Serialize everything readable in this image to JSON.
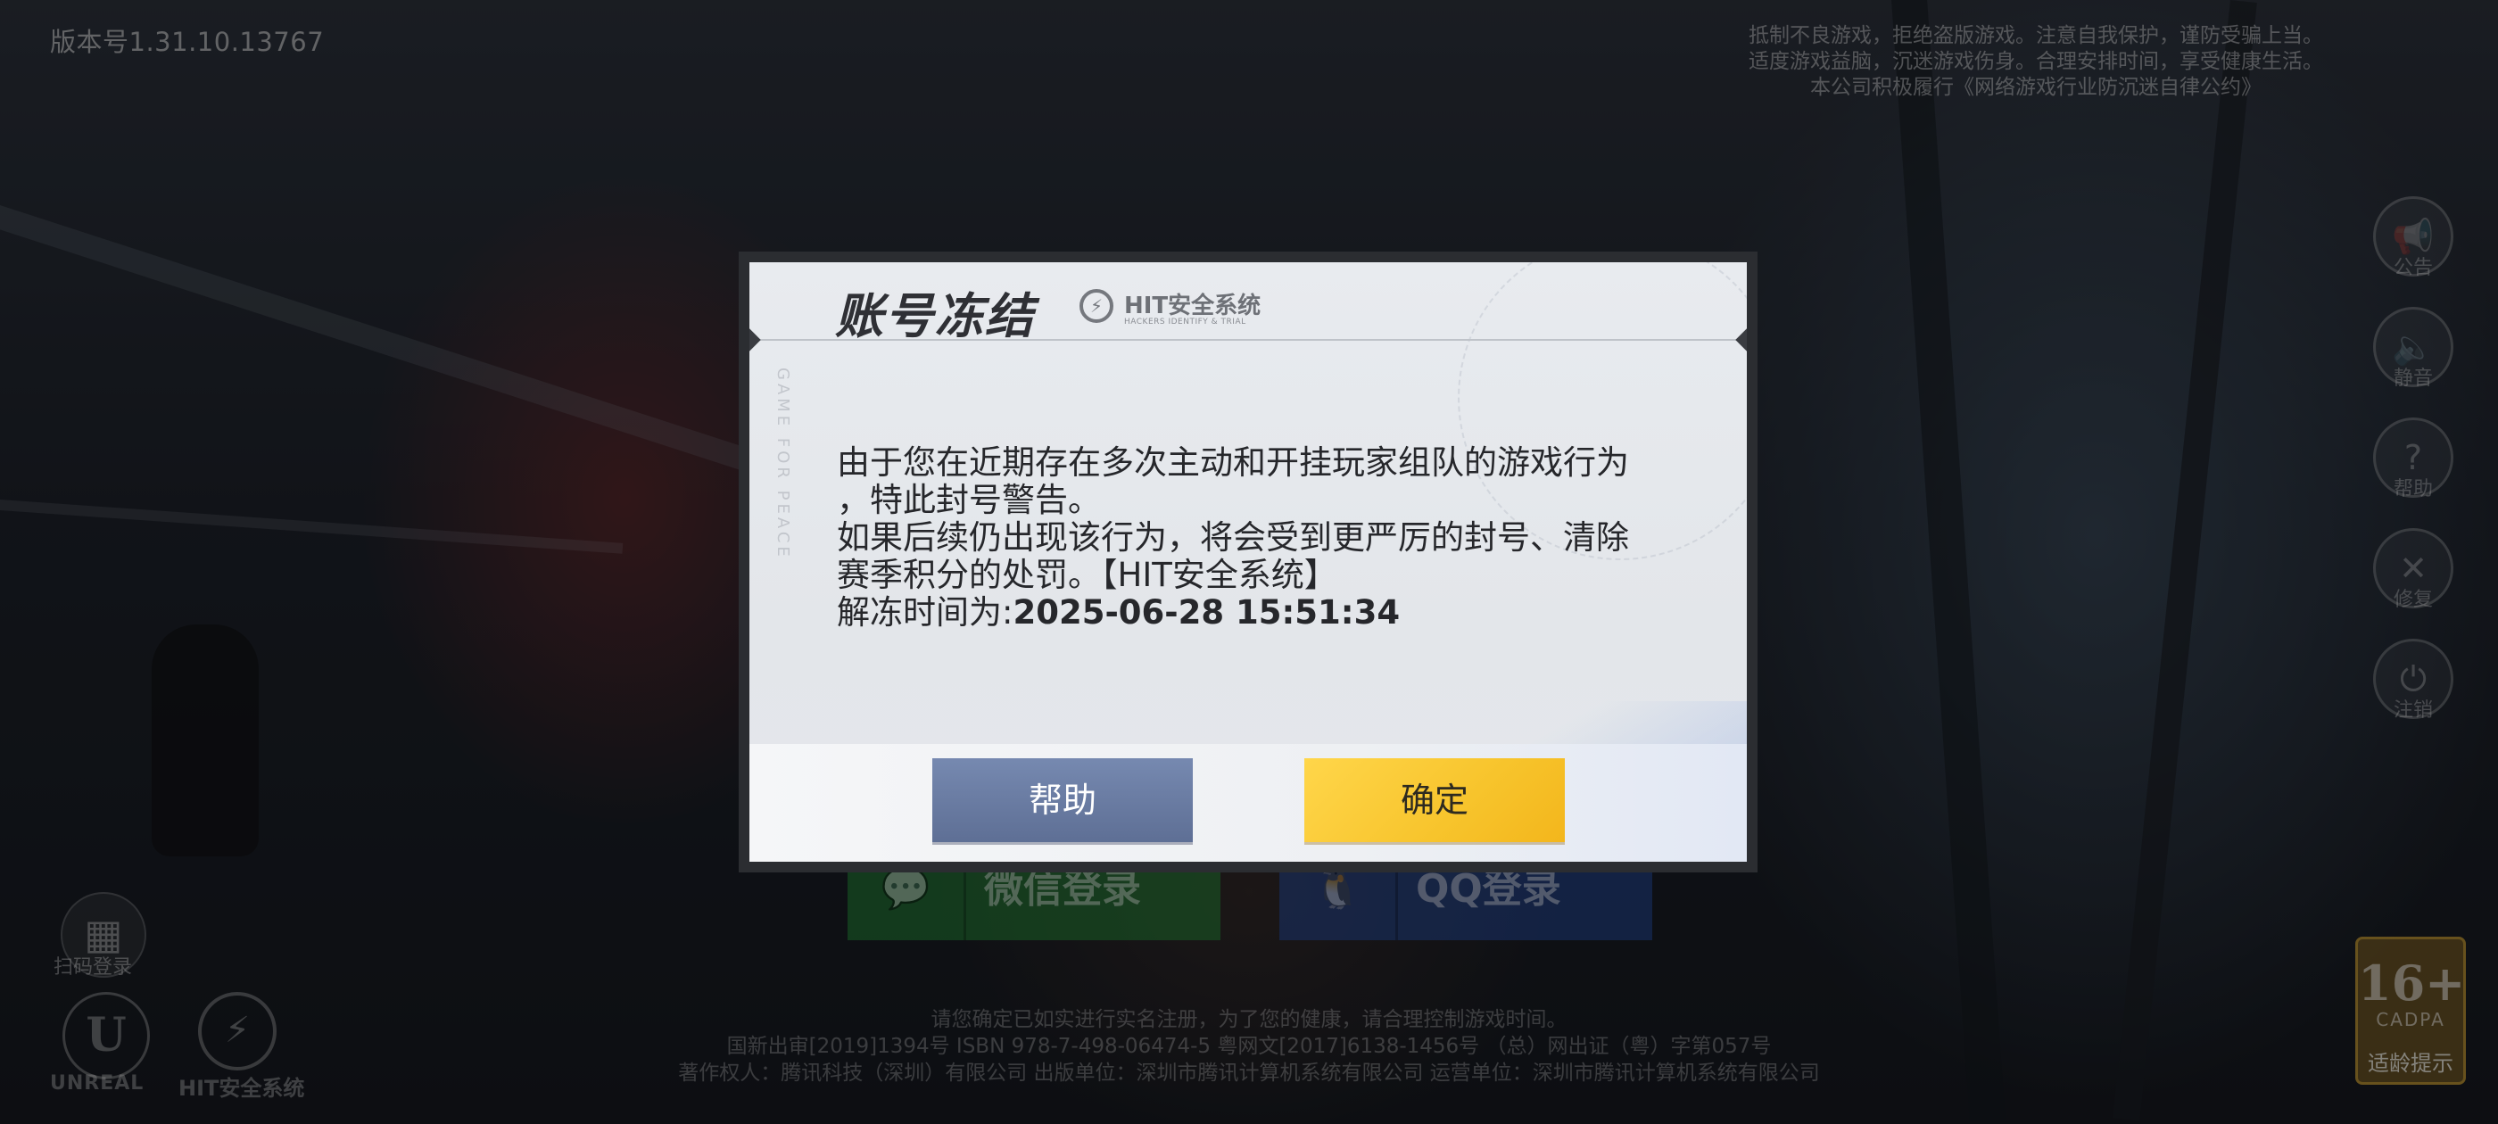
{
  "version_text": "版本号1.31.10.13767",
  "health_notice": {
    "line1": "抵制不良游戏，拒绝盗版游戏。注意自我保护，谨防受骗上当。",
    "line2": "适度游戏益脑，沉迷游戏伤身。合理安排时间，享受健康生活。",
    "line3": "本公司积极履行《网络游戏行业防沉迷自律公约》"
  },
  "side_menu": [
    {
      "label": "公告",
      "icon": "megaphone-icon",
      "glyph": "📢"
    },
    {
      "label": "静音",
      "icon": "speaker-icon",
      "glyph": "🔈"
    },
    {
      "label": "帮助",
      "icon": "question-icon",
      "glyph": "?"
    },
    {
      "label": "修复",
      "icon": "tools-icon",
      "glyph": "✕"
    },
    {
      "label": "注销",
      "icon": "power-icon",
      "glyph": "⏻"
    }
  ],
  "qr_label": "扫码登录",
  "engine_label": "UNREAL",
  "hit_logo_label": "HIT安全系统",
  "login": {
    "wechat_label": "微信登录",
    "qq_label": "QQ登录"
  },
  "footer": {
    "line1": "请您确定已如实进行实名注册，为了您的健康，请合理控制游戏时间。",
    "line2": "国新出审[2019]1394号   ISBN 978-7-498-06474-5   粤网文[2017]6138-1456号  （总）网出证（粤）字第057号",
    "line3": "著作权人：腾讯科技（深圳）有限公司   出版单位：深圳市腾讯计算机系统有限公司   运营单位：深圳市腾讯计算机系统有限公司"
  },
  "age_rating": {
    "number": "16+",
    "sub": "CADPA",
    "label": "适龄提示"
  },
  "dialog": {
    "title": "账号冻结",
    "badge_text": "HIT安全系统",
    "badge_sub": "HACKERS IDENTIFY & TRIAL",
    "vertical_text": "GAME FOR PEACE",
    "body_line1": "由于您在近期存在多次主动和开挂玩家组队的游戏行为",
    "body_line2": "，特此封号警告。",
    "body_line3": "如果后续仍出现该行为，将会受到更严厉的封号、清除",
    "body_line4": "赛季积分的处罚。【HIT安全系统】",
    "unfreeze_label": "解冻时间为:",
    "unfreeze_time": "2025-06-28 15:51:34",
    "help_button": "帮助",
    "confirm_button": "确定"
  }
}
